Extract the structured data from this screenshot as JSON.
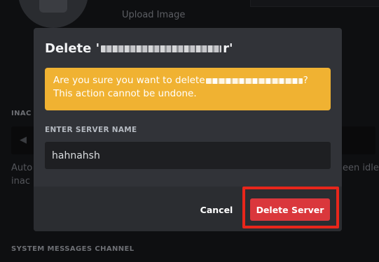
{
  "background": {
    "upload_label": "Upload Image",
    "section_inactive_fragment": "INAC",
    "description_line1_fragment": "Auto",
    "description_line2_fragment": "inac",
    "description_right_fragment": "een idle fo",
    "section_system_messages": "SYSTEM MESSAGES CHANNEL"
  },
  "modal": {
    "title_prefix": "Delete '",
    "title_suffix": "r'",
    "warning_prefix": "Are you sure you want to delete ",
    "warning_suffix": "?",
    "warning_line2": "This action cannot be undone.",
    "field_label": "ENTER SERVER NAME",
    "field_value": "hahnahsh",
    "cancel_label": "Cancel",
    "delete_label": "Delete Server"
  },
  "colors": {
    "warning": "#f0b232",
    "danger": "#da373c",
    "highlight": "#e8261b",
    "modal_bg": "#313338",
    "footer_bg": "#2b2d31"
  }
}
